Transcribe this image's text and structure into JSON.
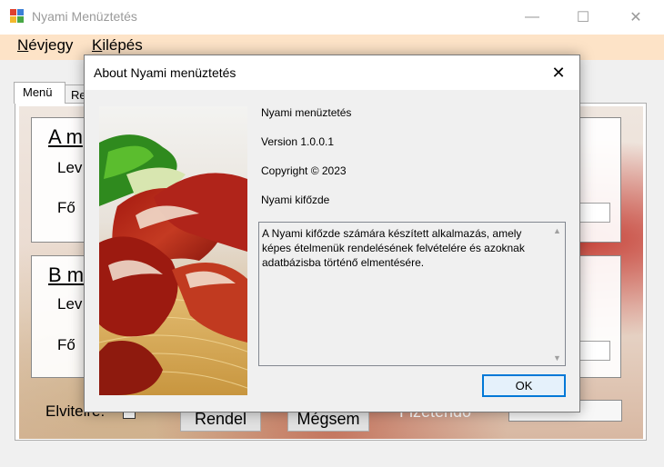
{
  "window": {
    "title": "Nyami Menüztetés",
    "minimize_glyph": "—",
    "maximize_glyph": "☐",
    "close_glyph": "✕"
  },
  "menubar": {
    "items": [
      {
        "first": "N",
        "rest": "évjegy"
      },
      {
        "first": "K",
        "rest": "ilépés"
      }
    ]
  },
  "tabs": [
    {
      "label": "Menü"
    },
    {
      "label": "Re"
    }
  ],
  "main": {
    "group_a": {
      "title": "A m",
      "label1": "Lev",
      "label2": "Fő"
    },
    "group_b": {
      "title": "B m",
      "label1": "Lev",
      "label2": "Fő"
    },
    "elvitelre_label": "Elvitelre:",
    "rendel_button": "Rendel",
    "megsem_button": "Mégsem",
    "fizetendo_label": "Fizetendő"
  },
  "dialog": {
    "title": "About Nyami menüztetés",
    "close_glyph": "✕",
    "product_name": "Nyami menüztetés",
    "version": "Version 1.0.0.1",
    "copyright": "Copyright ©  2023",
    "company": "Nyami kifőzde",
    "description": "A Nyami kifőzde számára készített alkalmazás, amely képes ételmenük rendelésének felvételére és azoknak adatbázisba történő elmentésére.",
    "ok_button": "OK"
  },
  "icons": [
    "app-icon",
    "food-image",
    "scroll-up-icon",
    "scroll-down-icon"
  ],
  "colors": {
    "menubar": "#fde3c7",
    "accent": "#0078d7",
    "ok_bg": "#e5f1fb"
  }
}
